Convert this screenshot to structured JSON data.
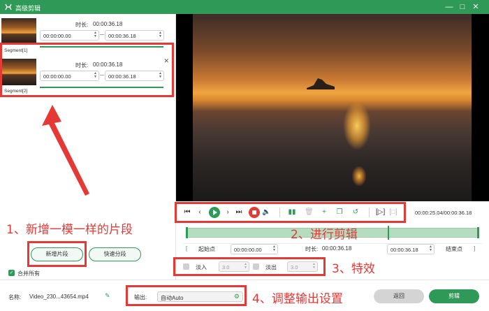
{
  "window": {
    "title": "高级剪辑",
    "min_icon": "minimize-icon",
    "max_icon": "maximize-icon",
    "close_icon": "close-icon"
  },
  "segments": [
    {
      "label": "Segment[1]",
      "duration_label": "时长:",
      "duration": "00:00:36.18",
      "start": "00:00:00.00",
      "end": "00:00:36.18"
    },
    {
      "label": "Segment[2]",
      "duration_label": "时长:",
      "duration": "00:00:36.18",
      "start": "00:00:00.00",
      "end": "00:00:36.18"
    }
  ],
  "left_actions": {
    "new_segment": "新增片段",
    "quick_split": "快速分段",
    "merge_all": "合并所有",
    "merge_checked": true
  },
  "player": {
    "timecode": "00:00:25.04/00:00:36.18",
    "playhead_fraction": 0.692
  },
  "range": {
    "start_btn": "起始点",
    "start": "00:00:00.00",
    "duration_label": "时长:",
    "duration": "00:00:36.18",
    "end": "00:00:36.18",
    "end_btn": "结束点"
  },
  "effects": {
    "fade_in_label": "淡入",
    "fade_in": "3.0",
    "fade_out_label": "淡出",
    "fade_out": "3.0"
  },
  "file": {
    "name_label": "名称:",
    "name": "Video_230...43654.mp4"
  },
  "output": {
    "label": "输出:",
    "value": "自动Auto"
  },
  "buttons": {
    "back": "返回",
    "clip": "剪辑"
  },
  "annotations": {
    "a1": "1、新增一模一样的片段",
    "a2": "2、进行剪辑",
    "a3": "3、特效",
    "a4": "4、调整输出设置"
  },
  "colors": {
    "accent": "#2f9a57",
    "annotation": "#e53935"
  }
}
